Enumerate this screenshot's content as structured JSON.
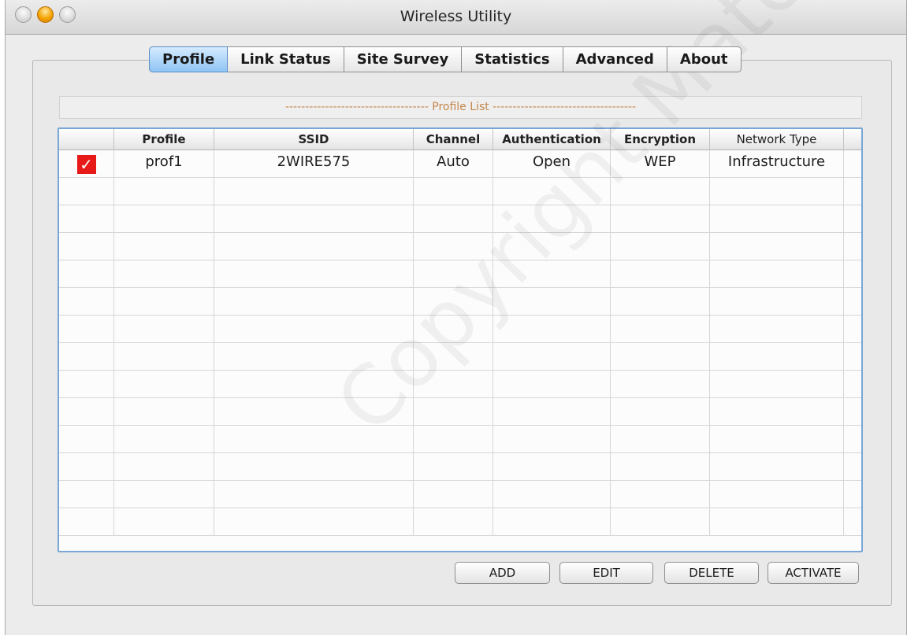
{
  "window": {
    "title": "Wireless Utility"
  },
  "tabs": [
    {
      "label": "Profile",
      "active": true
    },
    {
      "label": "Link Status",
      "active": false
    },
    {
      "label": "Site Survey",
      "active": false
    },
    {
      "label": "Statistics",
      "active": false
    },
    {
      "label": "Advanced",
      "active": false
    },
    {
      "label": "About",
      "active": false
    }
  ],
  "profile_list": {
    "title": "------------------------------------ Profile List ------------------------------------",
    "columns": [
      "",
      "Profile",
      "SSID",
      "Channel",
      "Authentication",
      "Encryption",
      "Network Type"
    ],
    "rows": [
      {
        "checked": true,
        "profile": "prof1",
        "ssid": "2WIRE575",
        "channel": "Auto",
        "authentication": "Open",
        "encryption": "WEP",
        "network_type": "Infrastructure"
      }
    ],
    "check_glyph": "✓"
  },
  "buttons": {
    "add": "ADD",
    "edit": "EDIT",
    "delete": "DELETE",
    "activate": "ACTIVATE"
  },
  "colors": {
    "active_tab": "#8fc4f3",
    "table_border": "#7aa6d6",
    "check_red": "#e81919"
  },
  "watermark": "Copyright Material"
}
